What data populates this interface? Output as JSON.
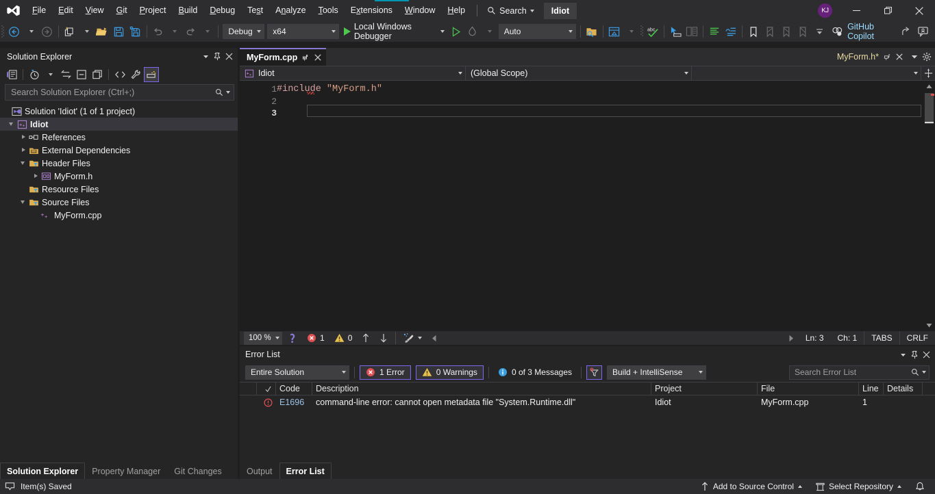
{
  "window": {
    "title": "Idiot",
    "solution_pill": "Idiot",
    "avatar_initials": "KJ",
    "minimize_label": "Minimize",
    "restore_label": "Restore",
    "close_label": "Close"
  },
  "menubar": {
    "items": [
      {
        "label": "File",
        "accel": "F"
      },
      {
        "label": "Edit",
        "accel": "E"
      },
      {
        "label": "View",
        "accel": "V"
      },
      {
        "label": "Git",
        "accel": "G"
      },
      {
        "label": "Project",
        "accel": "P"
      },
      {
        "label": "Build",
        "accel": "B"
      },
      {
        "label": "Debug",
        "accel": "D"
      },
      {
        "label": "Test",
        "accel": "s"
      },
      {
        "label": "Analyze",
        "accel": "n"
      },
      {
        "label": "Tools",
        "accel": "T"
      },
      {
        "label": "Extensions",
        "accel": "x"
      },
      {
        "label": "Window",
        "accel": "W"
      },
      {
        "label": "Help",
        "accel": "H"
      }
    ],
    "search_label": "Search"
  },
  "toolbar": {
    "navigate_back": "Navigate Backward",
    "navigate_forward": "Navigate Forward",
    "new_project": "New Project",
    "open_file": "Open File",
    "save": "Save",
    "save_all": "Save All",
    "undo": "Undo",
    "redo": "Redo",
    "configuration": "Debug",
    "platform": "x64",
    "start_debug": "Local Windows Debugger",
    "auto_select": "Auto",
    "copilot_label": "GitHub Copilot"
  },
  "solution_explorer": {
    "title": "Solution Explorer",
    "search_placeholder": "Search Solution Explorer (Ctrl+;)",
    "tabs": [
      {
        "label": "Solution Explorer",
        "active": true
      },
      {
        "label": "Property Manager",
        "active": false
      },
      {
        "label": "Git Changes",
        "active": false
      }
    ],
    "tree": [
      {
        "label": "Solution 'Idiot' (1 of 1 project)",
        "indent": 0,
        "twisty": "none",
        "icon": "solution-icon",
        "bold": false,
        "selected": false
      },
      {
        "label": "Idiot",
        "indent": 1,
        "twisty": "expanded",
        "icon": "cpp-project-icon",
        "bold": true,
        "selected": true
      },
      {
        "label": "References",
        "indent": 2,
        "twisty": "collapsed",
        "icon": "references-icon",
        "bold": false,
        "selected": false
      },
      {
        "label": "External Dependencies",
        "indent": 2,
        "twisty": "collapsed",
        "icon": "dependencies-icon",
        "bold": false,
        "selected": false
      },
      {
        "label": "Header Files",
        "indent": 2,
        "twisty": "expanded",
        "icon": "filter-folder-icon",
        "bold": false,
        "selected": false
      },
      {
        "label": "MyForm.h",
        "indent": 3,
        "twisty": "collapsed",
        "icon": "form-icon",
        "bold": false,
        "selected": false
      },
      {
        "label": "Resource Files",
        "indent": 2,
        "twisty": "none",
        "icon": "filter-folder-icon",
        "bold": false,
        "selected": false
      },
      {
        "label": "Source Files",
        "indent": 2,
        "twisty": "expanded",
        "icon": "filter-folder-icon",
        "bold": false,
        "selected": false
      },
      {
        "label": "MyForm.cpp",
        "indent": 3,
        "twisty": "none",
        "icon": "cpp-file-icon",
        "bold": false,
        "selected": false
      }
    ]
  },
  "editor": {
    "tab_label": "MyForm.cpp",
    "preview_tab_label": "MyForm.h*",
    "scope_left": "Idiot",
    "scope_right": "(Global Scope)",
    "lines": [
      {
        "num": "1",
        "prefix": "#include ",
        "string": "\"MyForm.h\""
      },
      {
        "num": "2",
        "prefix": "",
        "string": ""
      },
      {
        "num": "3",
        "prefix": "",
        "string": ""
      }
    ],
    "status": {
      "zoom": "100 %",
      "error_count": "1",
      "warning_count": "0",
      "line": "Ln: 3",
      "column": "Ch: 1",
      "tabs_mode": "TABS",
      "line_endings": "CRLF"
    }
  },
  "error_list": {
    "title": "Error List",
    "scope_filter": "Entire Solution",
    "errors_label": "1 Error",
    "warnings_label": "0 Warnings",
    "messages_label": "0 of 3 Messages",
    "build_filter": "Build + IntelliSense",
    "search_placeholder": "Search Error List",
    "columns": [
      "",
      "",
      "Code",
      "Description",
      "Project",
      "File",
      "Line",
      "Details"
    ],
    "rows": [
      {
        "severity": "error",
        "code": "E1696",
        "description": "command-line error: cannot open metadata file \"System.Runtime.dll\"",
        "project": "Idiot",
        "file": "MyForm.cpp",
        "line": "1",
        "details": ""
      }
    ],
    "tabs": [
      {
        "label": "Output",
        "active": false
      },
      {
        "label": "Error List",
        "active": true
      }
    ]
  },
  "statusbar": {
    "message": "Item(s) Saved",
    "add_to_source_control": "Add to Source Control",
    "select_repository": "Select Repository"
  },
  "colors": {
    "accent_purple": "#8878d4",
    "chrome": "#2d2d30",
    "panel": "#252526",
    "editor_bg": "#1e1e1e",
    "error_red": "#e05050",
    "warning_yellow": "#e8c14d",
    "info_blue": "#3b9fe0",
    "link_blue": "#9cc3e5",
    "avatar_purple": "#68217a",
    "run_green": "#4ec94e"
  }
}
